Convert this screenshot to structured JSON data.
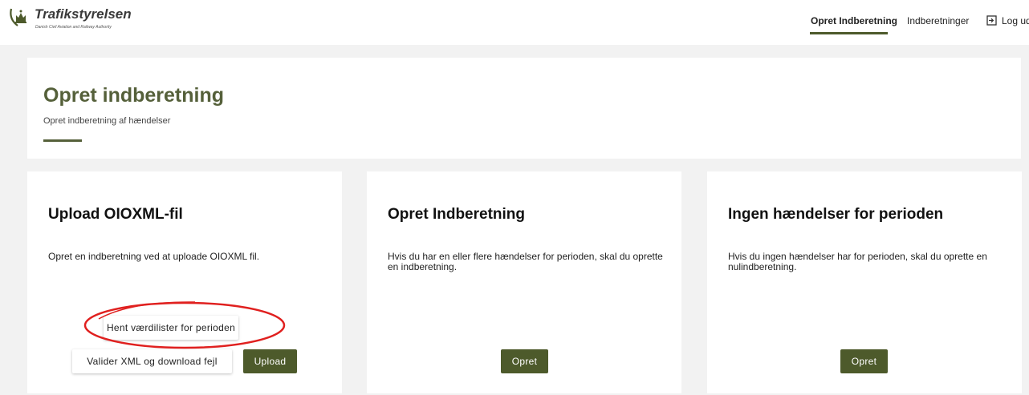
{
  "header": {
    "logo_name": "Trafikstyrelsen",
    "logo_subtitle": "Danish Civil Aviation and Railway Authority",
    "nav": {
      "create": "Opret Indberetning",
      "reports": "Indberetninger",
      "logout": "Log ud"
    }
  },
  "hero": {
    "title": "Opret indberetning",
    "subtitle": "Opret indberetning af hændelser"
  },
  "cards": {
    "upload": {
      "title": "Upload OIOXML-fil",
      "text": "Opret en indberetning ved at uploade OIOXML fil.",
      "fetch_button": "Hent værdilister for perioden",
      "validate_button": "Valider XML og download fejl",
      "upload_button": "Upload"
    },
    "create": {
      "title": "Opret Indberetning",
      "text": "Hvis du har en eller flere hændelser for perioden, skal du oprette en indberetning.",
      "button": "Opret"
    },
    "none": {
      "title": "Ingen hændelser for perioden",
      "text": "Hvis du ingen hændelser har for perioden, skal du oprette en nulindberetning.",
      "button": "Opret"
    }
  },
  "colors": {
    "accent": "#4d5a2b",
    "title": "#55603a",
    "annotation": "#e0201f"
  },
  "icons": {
    "logo": "crown-logo-icon",
    "logout": "logout-icon"
  }
}
